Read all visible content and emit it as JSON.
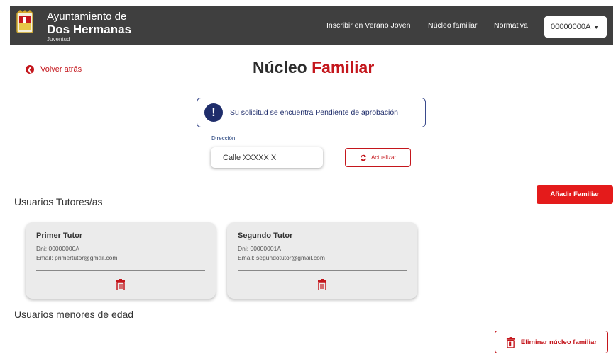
{
  "header": {
    "brand_line1": "Ayuntamiento de",
    "brand_line2": "Dos Hermanas",
    "brand_line3": "Juventud",
    "nav": [
      "Inscribir en Verano Joven",
      "Núcleo familiar",
      "Normativa"
    ],
    "user_id": "00000000A",
    "colors": {
      "bar": "#3f3f3f",
      "accent": "#c4161c"
    }
  },
  "back_label": "Volver atrás",
  "title": {
    "part1": "Núcleo",
    "part2": "Familiar"
  },
  "alert": {
    "icon": "exclamation-icon",
    "text": "Su solicitud se encuentra Pendiente de aprobación"
  },
  "address": {
    "label": "Dirección",
    "value": "Calle XXXXX X",
    "update_label": "Actualizar"
  },
  "tutors_section": "Usuarios Tutores/as",
  "add_label": "Añadir Familiar",
  "tutors": [
    {
      "title": "Primer Tutor",
      "dni": "Dni: 00000000A",
      "email": "Email: primertutor@gmail.com"
    },
    {
      "title": "Segundo Tutor",
      "dni": "Dni: 00000001A",
      "email": "Email: segundotutor@gmail.com"
    }
  ],
  "minors_section": "Usuarios menores de edad",
  "delete_label": "Eliminar núcleo familiar"
}
